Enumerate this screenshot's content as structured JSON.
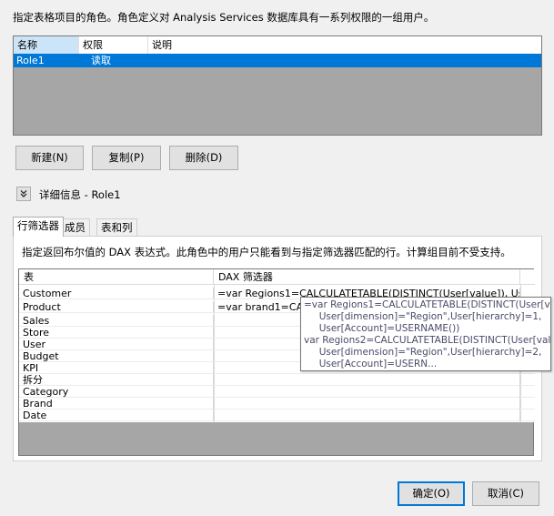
{
  "description": "指定表格项目的角色。角色定义对 Analysis Services 数据库具有一系列权限的一组用户。",
  "roles_list": {
    "columns": [
      "名称",
      "权限",
      "说明"
    ],
    "rows": [
      {
        "name": "Role1",
        "permission": "读取",
        "description": ""
      }
    ]
  },
  "role_buttons": {
    "new": "新建(N)",
    "copy": "复制(P)",
    "delete": "删除(D)"
  },
  "details": {
    "title": "详细信息 - Role1"
  },
  "tabs": [
    {
      "label": "行筛选器",
      "active": true
    },
    {
      "label": "成员",
      "active": false
    },
    {
      "label": "表和列",
      "active": false
    }
  ],
  "row_filters": {
    "instruction": "指定返回布尔值的 DAX 表达式。此角色中的用户只能看到与指定筛选器匹配的行。计算组目前不受支持。",
    "columns": [
      "表",
      "DAX 筛选器"
    ],
    "rows": [
      {
        "table": "Customer",
        "filter": "=var Regions1=CALCULATETABLE(DISTINCT(User[value]),     User[di..."
      },
      {
        "table": "Product",
        "filter": "=var brand1=CALC"
      },
      {
        "table": "Sales",
        "filter": ""
      },
      {
        "table": "Store",
        "filter": ""
      },
      {
        "table": "User",
        "filter": ""
      },
      {
        "table": "Budget",
        "filter": ""
      },
      {
        "table": "KPI",
        "filter": ""
      },
      {
        "table": "拆分",
        "filter": ""
      },
      {
        "table": "Category",
        "filter": ""
      },
      {
        "table": "Brand",
        "filter": ""
      },
      {
        "table": "Date",
        "filter": ""
      }
    ],
    "tooltip": "=var Regions1=CALCULATETABLE(DISTINCT(User[value]),\n     User[dimension]=\"Region\",User[hierarchy]=1,\n     User[Account]=USERNAME())\nvar Regions2=CALCULATETABLE(DISTINCT(User[value]),\n     User[dimension]=\"Region\",User[hierarchy]=2,\n     User[Account]=USERN..."
  },
  "dialog_buttons": {
    "ok": "确定(O)",
    "cancel": "取消(C)"
  },
  "colors": {
    "selection": "#0078d7",
    "header_selected": "#cce4f7",
    "grid_empty": "#a6a6a6"
  },
  "icons": {
    "expander": "chevron-double-down-icon"
  }
}
